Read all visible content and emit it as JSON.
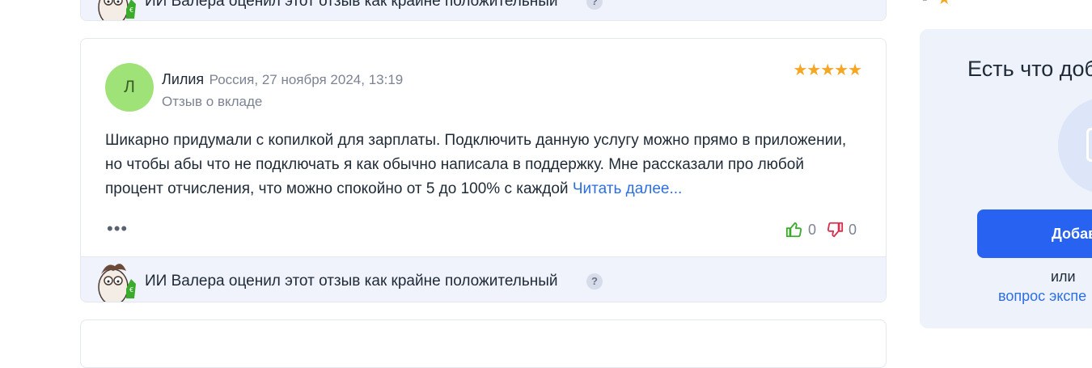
{
  "top_card": {
    "ai_text": "ИИ Валера оценил этот отзыв как крайне положительный",
    "help_icon": "?"
  },
  "review": {
    "avatar_letter": "Л",
    "author": "Лилия",
    "meta": "Россия, 27 ноября 2024, 13:19",
    "type": "Отзыв о вкладе",
    "rating_stars": "★★★★★",
    "rating": 5,
    "text": "Шикарно придумали с копилкой для зарплаты. Подключить данную услугу можно прямо в приложении, но чтобы абы что не подключать я как обычно написала в поддержку. Мне рассказали про любой процент отчисления, что можно спокойно от 5 до 100% с каждой",
    "read_more": "Читать далее...",
    "more_menu": "•••",
    "likes": "0",
    "dislikes": "0",
    "ai_text": "ИИ Валера оценил этот отзыв как крайне положительный",
    "help_icon": "?"
  },
  "sidebar": {
    "title": "Есть что доб",
    "button_label": "Добав",
    "or_text": "или",
    "link_text": "вопрос экспе"
  },
  "top_fragment": {
    "dash": "-",
    "star": "★"
  },
  "colors": {
    "accent": "#2862f0",
    "link": "#2d6fe0",
    "star": "#f5a623",
    "avatar": "#9ee278",
    "like": "#3bab2c",
    "dislike": "#d9304f"
  }
}
